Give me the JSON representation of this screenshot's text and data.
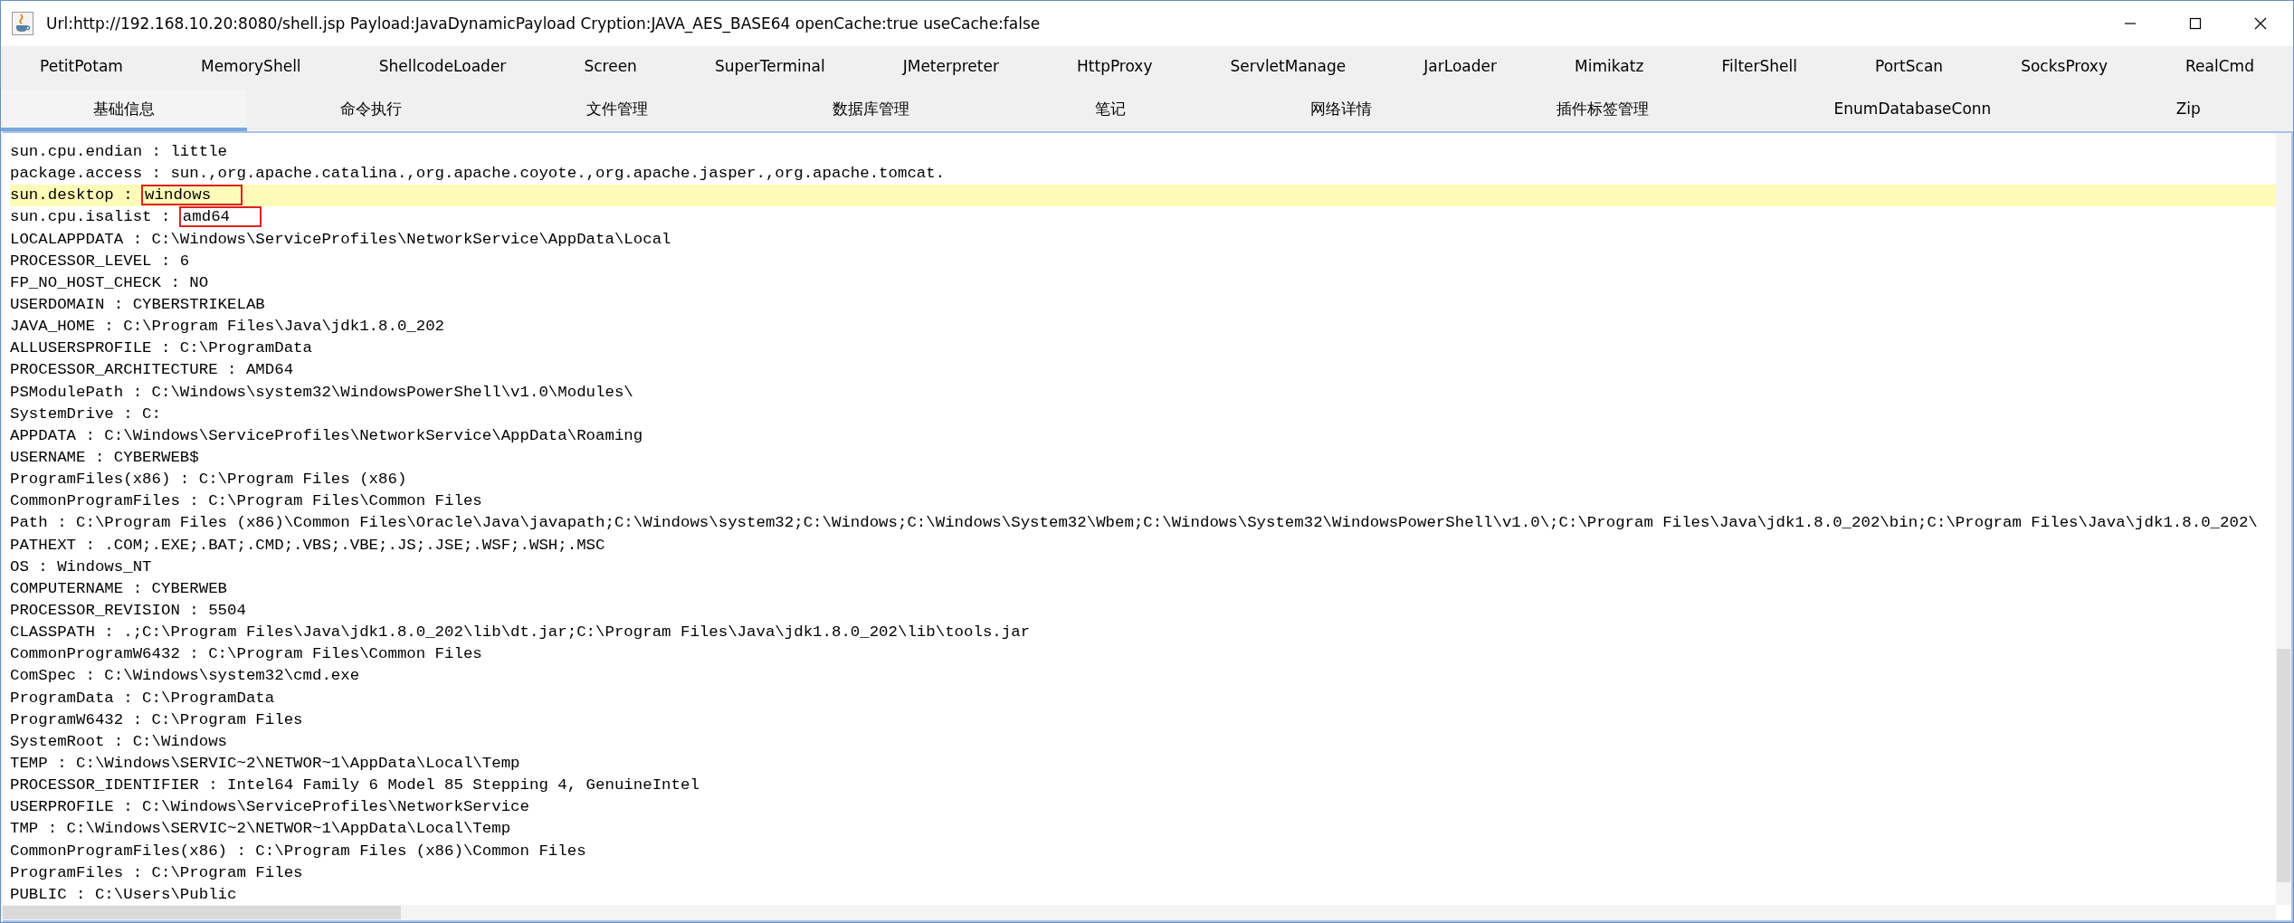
{
  "window": {
    "title": "Url:http://192.168.10.20:8080/shell.jsp Payload:JavaDynamicPayload Cryption:JAVA_AES_BASE64 openCache:true useCache:false"
  },
  "tab_rows": [
    {
      "tabs": [
        {
          "label": "PetitPotam",
          "selected": false
        },
        {
          "label": "MemoryShell",
          "selected": false
        },
        {
          "label": "ShellcodeLoader",
          "selected": false
        },
        {
          "label": "Screen",
          "selected": false
        },
        {
          "label": "SuperTerminal",
          "selected": false
        },
        {
          "label": "JMeterpreter",
          "selected": false
        },
        {
          "label": "HttpProxy",
          "selected": false
        },
        {
          "label": "ServletManage",
          "selected": false
        },
        {
          "label": "JarLoader",
          "selected": false
        },
        {
          "label": "Mimikatz",
          "selected": false
        },
        {
          "label": "FilterShell",
          "selected": false
        },
        {
          "label": "PortScan",
          "selected": false
        },
        {
          "label": "SocksProxy",
          "selected": false
        },
        {
          "label": "RealCmd",
          "selected": false
        }
      ]
    },
    {
      "tabs": [
        {
          "label": "基础信息",
          "selected": true
        },
        {
          "label": "命令执行",
          "selected": false
        },
        {
          "label": "文件管理",
          "selected": false
        },
        {
          "label": "数据库管理",
          "selected": false
        },
        {
          "label": "笔记",
          "selected": false
        },
        {
          "label": "网络详情",
          "selected": false
        },
        {
          "label": "插件标签管理",
          "selected": false
        },
        {
          "label": "EnumDatabaseConn",
          "selected": false
        },
        {
          "label": "Zip",
          "selected": false
        }
      ]
    }
  ],
  "output": {
    "lines": [
      {
        "text": "sun.cpu.endian : little",
        "highlighted": false,
        "boxed": false
      },
      {
        "text": "package.access : sun.,org.apache.catalina.,org.apache.coyote.,org.apache.jasper.,org.apache.tomcat.",
        "highlighted": false,
        "boxed": false
      },
      {
        "text": "sun.desktop : windows",
        "highlighted": true,
        "boxed": true
      },
      {
        "text": "sun.cpu.isalist : amd64",
        "highlighted": false,
        "boxed": true
      },
      {
        "text": "LOCALAPPDATA : C:\\Windows\\ServiceProfiles\\NetworkService\\AppData\\Local",
        "highlighted": false,
        "boxed": false
      },
      {
        "text": "PROCESSOR_LEVEL : 6",
        "highlighted": false,
        "boxed": false
      },
      {
        "text": "FP_NO_HOST_CHECK : NO",
        "highlighted": false,
        "boxed": false
      },
      {
        "text": "USERDOMAIN : CYBERSTRIKELAB",
        "highlighted": false,
        "boxed": false
      },
      {
        "text": "JAVA_HOME : C:\\Program Files\\Java\\jdk1.8.0_202",
        "highlighted": false,
        "boxed": false
      },
      {
        "text": "ALLUSERSPROFILE : C:\\ProgramData",
        "highlighted": false,
        "boxed": false
      },
      {
        "text": "PROCESSOR_ARCHITECTURE : AMD64",
        "highlighted": false,
        "boxed": false
      },
      {
        "text": "PSModulePath : C:\\Windows\\system32\\WindowsPowerShell\\v1.0\\Modules\\",
        "highlighted": false,
        "boxed": false
      },
      {
        "text": "SystemDrive : C:",
        "highlighted": false,
        "boxed": false
      },
      {
        "text": "APPDATA : C:\\Windows\\ServiceProfiles\\NetworkService\\AppData\\Roaming",
        "highlighted": false,
        "boxed": false
      },
      {
        "text": "USERNAME : CYBERWEB$",
        "highlighted": false,
        "boxed": false
      },
      {
        "text": "ProgramFiles(x86) : C:\\Program Files (x86)",
        "highlighted": false,
        "boxed": false
      },
      {
        "text": "CommonProgramFiles : C:\\Program Files\\Common Files",
        "highlighted": false,
        "boxed": false
      },
      {
        "text": "Path : C:\\Program Files (x86)\\Common Files\\Oracle\\Java\\javapath;C:\\Windows\\system32;C:\\Windows;C:\\Windows\\System32\\Wbem;C:\\Windows\\System32\\WindowsPowerShell\\v1.0\\;C:\\Program Files\\Java\\jdk1.8.0_202\\bin;C:\\Program Files\\Java\\jdk1.8.0_202\\",
        "highlighted": false,
        "boxed": false
      },
      {
        "text": "PATHEXT : .COM;.EXE;.BAT;.CMD;.VBS;.VBE;.JS;.JSE;.WSF;.WSH;.MSC",
        "highlighted": false,
        "boxed": false
      },
      {
        "text": "OS : Windows_NT",
        "highlighted": false,
        "boxed": false
      },
      {
        "text": "COMPUTERNAME : CYBERWEB",
        "highlighted": false,
        "boxed": false
      },
      {
        "text": "PROCESSOR_REVISION : 5504",
        "highlighted": false,
        "boxed": false
      },
      {
        "text": "CLASSPATH : .;C:\\Program Files\\Java\\jdk1.8.0_202\\lib\\dt.jar;C:\\Program Files\\Java\\jdk1.8.0_202\\lib\\tools.jar",
        "highlighted": false,
        "boxed": false
      },
      {
        "text": "CommonProgramW6432 : C:\\Program Files\\Common Files",
        "highlighted": false,
        "boxed": false
      },
      {
        "text": "ComSpec : C:\\Windows\\system32\\cmd.exe",
        "highlighted": false,
        "boxed": false
      },
      {
        "text": "ProgramData : C:\\ProgramData",
        "highlighted": false,
        "boxed": false
      },
      {
        "text": "ProgramW6432 : C:\\Program Files",
        "highlighted": false,
        "boxed": false
      },
      {
        "text": "SystemRoot : C:\\Windows",
        "highlighted": false,
        "boxed": false
      },
      {
        "text": "TEMP : C:\\Windows\\SERVIC~2\\NETWOR~1\\AppData\\Local\\Temp",
        "highlighted": false,
        "boxed": false
      },
      {
        "text": "PROCESSOR_IDENTIFIER : Intel64 Family 6 Model 85 Stepping 4, GenuineIntel",
        "highlighted": false,
        "boxed": false
      },
      {
        "text": "USERPROFILE : C:\\Windows\\ServiceProfiles\\NetworkService",
        "highlighted": false,
        "boxed": false
      },
      {
        "text": "TMP : C:\\Windows\\SERVIC~2\\NETWOR~1\\AppData\\Local\\Temp",
        "highlighted": false,
        "boxed": false
      },
      {
        "text": "CommonProgramFiles(x86) : C:\\Program Files (x86)\\Common Files",
        "highlighted": false,
        "boxed": false
      },
      {
        "text": "ProgramFiles : C:\\Program Files",
        "highlighted": false,
        "boxed": false
      },
      {
        "text": "PUBLIC : C:\\Users\\Public",
        "highlighted": false,
        "boxed": false
      }
    ]
  }
}
